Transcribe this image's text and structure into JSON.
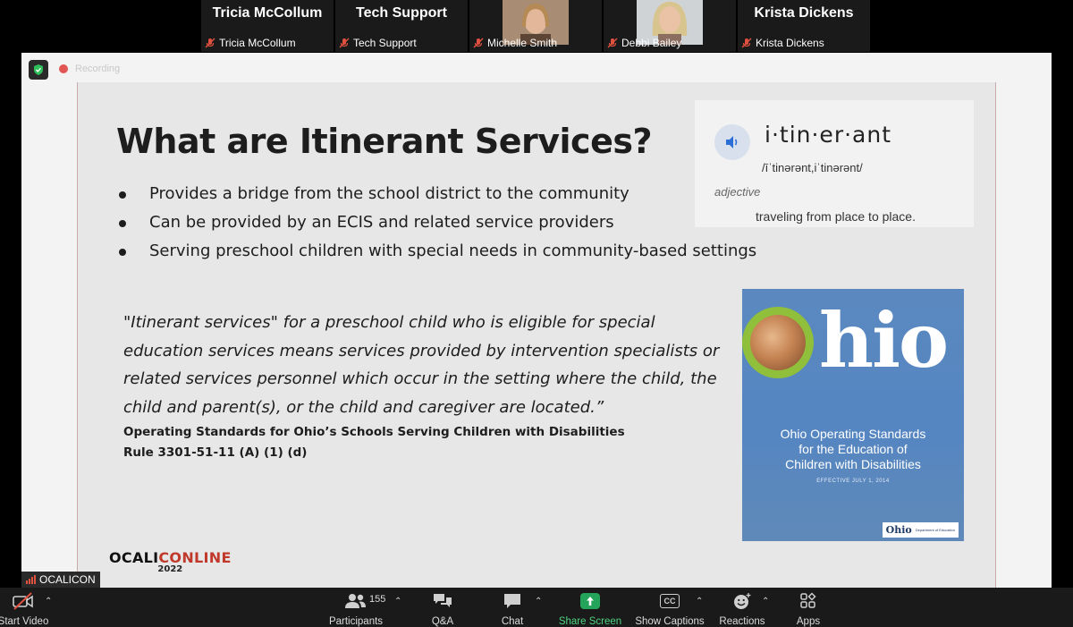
{
  "participants": [
    {
      "name": "Tricia McCollum",
      "label": "Tricia McCollum",
      "video": false
    },
    {
      "name": "Tech Support",
      "label": "Tech Support",
      "video": false
    },
    {
      "name": "Michelle Smith",
      "label": "Michelle Smith",
      "video": true
    },
    {
      "name": "Debbi Bailey",
      "label": "Debbi Bailey",
      "video": true
    },
    {
      "name": "Krista Dickens",
      "label": "Krista Dickens",
      "video": false
    }
  ],
  "recording": {
    "label": "Recording"
  },
  "slide": {
    "title": "What are Itinerant Services?",
    "bullets": [
      "Provides a bridge from the school district to the community",
      "Can be provided by an ECIS and related service providers",
      "Serving preschool children with special needs in community-based settings"
    ],
    "quote": "\"Itinerant services\" for a preschool child who is eligible for special education services means services provided by intervention specialists or related services personnel which occur in the setting where the child, the child and parent(s), or the child and caregiver are located.”",
    "cite_line1": "Operating Standards for Ohio’s Schools Serving Children with Disabilities",
    "cite_line2": "Rule 3301-51-11 (A) (1) (d)",
    "dictionary": {
      "word": "i·tin·er·ant",
      "phonetic": "/īˈtinərənt,iˈtinərənt/",
      "part_of_speech": "adjective",
      "definition": "traveling from place to place."
    },
    "cover": {
      "logo_text": "hio",
      "title_line1": "Ohio Operating Standards",
      "title_line2": "for the Education of",
      "title_line3": "Children with Disabilities",
      "effective": "EFFECTIVE JULY 1, 2014",
      "badge_logo": "Ohio",
      "badge_dept": "Department of Education"
    },
    "brand": {
      "name_prefix": "OCALI",
      "name_suffix": "CONLINE",
      "year": "2022"
    }
  },
  "presenter_tag": "OCALICON",
  "toolbar": {
    "start_video": "Start Video",
    "participants": "Participants",
    "participant_count": "155",
    "qa": "Q&A",
    "chat": "Chat",
    "share_screen": "Share Screen",
    "show_captions": "Show Captions",
    "reactions": "Reactions",
    "apps": "Apps"
  },
  "colors": {
    "share_green": "#24a35a",
    "muted_red": "#e0513f",
    "cover_blue": "#5586c2"
  }
}
